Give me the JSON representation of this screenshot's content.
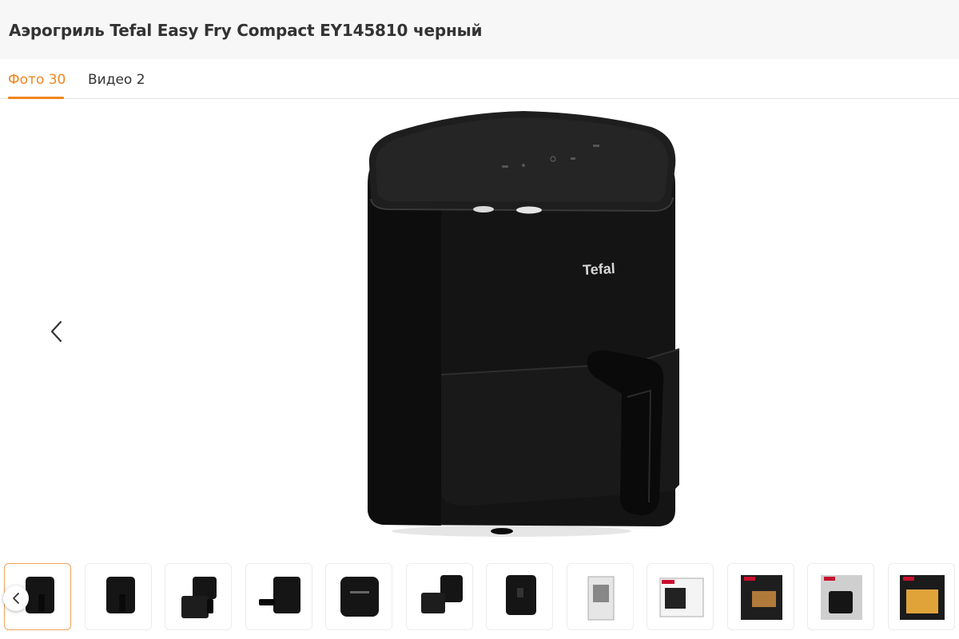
{
  "product": {
    "title": "Аэрогриль Tefal Easy Fry Compact EY145810 черный"
  },
  "tabs": [
    {
      "label": "Фото 30",
      "active": true
    },
    {
      "label": "Видео 2",
      "active": false
    }
  ],
  "main_image": {
    "brand_logo_text": "Tefal",
    "icon": "air-fryer-photo"
  },
  "gallery": {
    "prev_icon": "chevron-left-icon",
    "thumbnails": [
      {
        "icon": "air-fryer-front-thumb",
        "active": true
      },
      {
        "icon": "air-fryer-front-thumb",
        "active": false
      },
      {
        "icon": "air-fryer-open-basket-thumb",
        "active": false
      },
      {
        "icon": "air-fryer-side-thumb",
        "active": false
      },
      {
        "icon": "air-fryer-top-panel-thumb",
        "active": false
      },
      {
        "icon": "air-fryer-basket-out-thumb",
        "active": false
      },
      {
        "icon": "air-fryer-back-thumb",
        "active": false
      },
      {
        "icon": "manual-thumb",
        "active": false
      },
      {
        "icon": "box-package-thumb",
        "active": false
      },
      {
        "icon": "promo-food-thumb",
        "active": false
      },
      {
        "icon": "promo-kitchen-thumb",
        "active": false
      },
      {
        "icon": "promo-fries-thumb",
        "active": false
      }
    ]
  },
  "colors": {
    "accent": "#f0861e",
    "header_bg": "#f7f7f7",
    "product_body": "#1b1b1b"
  }
}
